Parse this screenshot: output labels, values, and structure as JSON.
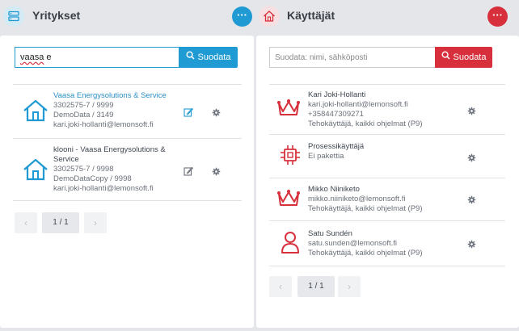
{
  "companies": {
    "title": "Yritykset",
    "more_label": "···",
    "search": {
      "value": "vaasa e",
      "value_part1": "vaasa",
      "value_part2": " e"
    },
    "filter_label": "Suodata",
    "items": [
      {
        "name": "Vaasa Energysolutions & Service",
        "line2": "3302575-7 / 9999",
        "line3": "DemoData / 3149",
        "line4": "kari.joki-hollanti@lemonsoft.fi"
      },
      {
        "name": "klooni - Vaasa Energysolutions &",
        "name2": "Service",
        "line2": "3302575-7 / 9998",
        "line3": "DemoDataCopy / 9998",
        "line4": "kari.joki-hollanti@lemonsoft.fi"
      }
    ],
    "pager": {
      "prev": "‹",
      "page": "1 / 1",
      "next": "›"
    }
  },
  "users": {
    "title": "Käyttäjät",
    "more_label": "···",
    "search": {
      "placeholder": "Suodata: nimi, sähköposti"
    },
    "filter_label": "Suodata",
    "items": [
      {
        "icon": "crown-icon",
        "name": "Kari Joki-Hollanti",
        "line2": "kari.joki-hollanti@lemonsoft.fi",
        "line3": "+358447309271",
        "line4": "Tehokäyttäjä, kaikki ohjelmat (P9)"
      },
      {
        "icon": "chip-icon",
        "name": "Prosessikäyttäjä",
        "line2": "Ei pakettia"
      },
      {
        "icon": "crown-icon",
        "name": "Mikko Niiniketo",
        "line2": "mikko.niiniketo@lemonsoft.fi",
        "line3": "Tehokäyttäjä, kaikki ohjelmat (P9)"
      },
      {
        "icon": "user-icon",
        "name": "Satu Sundén",
        "line2": "satu.sunden@lemonsoft.fi",
        "line3": "Tehokäyttäjä, kaikki ohjelmat (P9)"
      }
    ],
    "pager": {
      "prev": "‹",
      "page": "1 / 1",
      "next": "›"
    }
  },
  "colors": {
    "blue": "#209ad3",
    "red": "#d7303c",
    "background": "#e4e6e9"
  }
}
